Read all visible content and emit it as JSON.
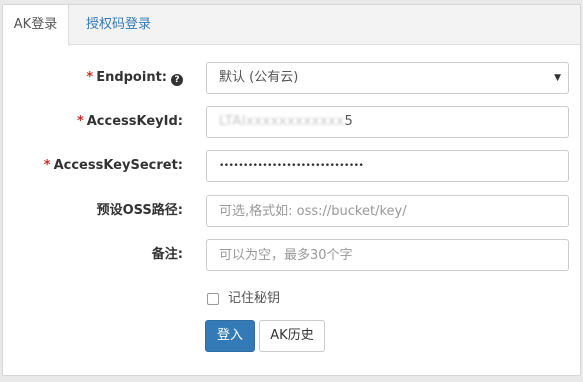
{
  "tabs": {
    "ak_login": "AK登录",
    "auth_code_login": "授权码登录"
  },
  "form": {
    "required_mark": "*",
    "endpoint": {
      "label": "Endpoint:",
      "help_icon": "question-circle-icon",
      "value": "默认 (公有云)"
    },
    "access_key_id": {
      "label": "AccessKeyId:",
      "value_suffix": "5"
    },
    "access_key_secret": {
      "label": "AccessKeySecret:",
      "value": "••••••••••••••••••••••••••••••"
    },
    "oss_path": {
      "label": "预设OSS路径:",
      "placeholder": "可选,格式如: oss://bucket/key/"
    },
    "remark": {
      "label": "备注:",
      "placeholder": "可以为空，最多30个字"
    },
    "remember_secret": {
      "label": "记住秘钥",
      "checked": false
    }
  },
  "buttons": {
    "login": "登入",
    "ak_history": "AK历史"
  },
  "colors": {
    "primary": "#337ab7",
    "required": "#c9302c",
    "link": "#337ab7"
  }
}
